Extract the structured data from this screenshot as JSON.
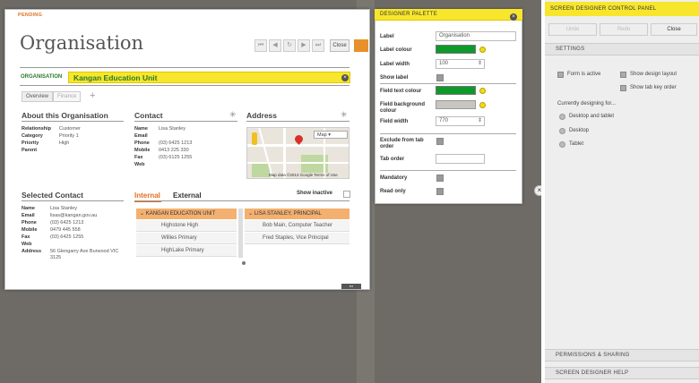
{
  "status": "PENDING",
  "title": "Organisation",
  "toolbar": {
    "first": "⏮",
    "prev": "◀",
    "refresh": "↻",
    "next": "▶",
    "last": "⏭",
    "close": "Close"
  },
  "org": {
    "label": "ORGANISATION",
    "name": "Kangan Education Unit"
  },
  "tabs": [
    "Overview",
    "Finance"
  ],
  "about": {
    "heading": "About this Organisation",
    "fields": [
      {
        "k": "Relationship",
        "v": "Customer"
      },
      {
        "k": "Category",
        "v": "Priority 1"
      },
      {
        "k": "Priority",
        "v": "High"
      },
      {
        "k": "Parent",
        "v": ""
      }
    ]
  },
  "contact": {
    "heading": "Contact",
    "fields": [
      {
        "k": "Name",
        "v": "Lisa Stanley"
      },
      {
        "k": "Email",
        "v": ""
      },
      {
        "k": "Phone",
        "v": "(03) 6425 1213"
      },
      {
        "k": "Mobile",
        "v": "0413 225 330"
      },
      {
        "k": "Fax",
        "v": "(03) 6125 1255"
      },
      {
        "k": "Web",
        "v": ""
      }
    ]
  },
  "address": {
    "heading": "Address",
    "map_type": "Map",
    "map_footer": "Map data ©2013 Google   Terms of Use"
  },
  "selected_contact": {
    "heading": "Selected Contact",
    "fields": [
      {
        "k": "Name",
        "v": "Lisa Stanley"
      },
      {
        "k": "Email",
        "v": "lisas@kangan.gov.au"
      },
      {
        "k": "Phone",
        "v": "(03) 6425 1213"
      },
      {
        "k": "Mobile",
        "v": "0479 445 558"
      },
      {
        "k": "Fax",
        "v": "(03) 6425 1255"
      },
      {
        "k": "Web",
        "v": ""
      },
      {
        "k": "Address",
        "v": "56 Glengarry Ave Burwood VIC 3125"
      }
    ]
  },
  "relations": {
    "tab_internal": "Internal",
    "tab_external": "External",
    "show_inactive": "Show inactive",
    "left": {
      "header": "KANGAN EDUCATION UNIT",
      "rows": [
        "Highstone High",
        "Willies Primary",
        "HighLake Primary"
      ]
    },
    "right": {
      "header": "LISA STANLEY, PRINCIPAL",
      "rows": [
        "Bob Main, Computer Teacher",
        "Fred Staples, Vice Principal"
      ]
    }
  },
  "palette": {
    "title": "DESIGNER PALETTE",
    "label_label": "Label",
    "label_value": "Organisation",
    "label_colour": "Label colour",
    "label_width": "Label width",
    "label_width_value": "100",
    "show_label": "Show label",
    "field_text_colour": "Field text colour",
    "field_bg_colour": "Field background colour",
    "field_width": "Field width",
    "field_width_value": "770",
    "exclude_tab": "Exclude from tab order",
    "tab_order": "Tab order",
    "mandatory": "Mandatory",
    "read_only": "Read only"
  },
  "control_panel": {
    "title": "SCREEN DESIGNER CONTROL PANEL",
    "undo": "Undo",
    "redo": "Redo",
    "close": "Close",
    "settings": "SETTINGS",
    "form_active": "Form is active",
    "show_design_layout": "Show design layout",
    "show_tab_key_order": "Show tab key order",
    "designing_for": "Currently designing for...",
    "options": [
      "Desktop and tablet",
      "Desktop",
      "Tablet"
    ],
    "permissions": "PERMISSIONS & SHARING",
    "help": "SCREEN DESIGNER HELP"
  },
  "colors": {
    "accent_yellow": "#f7e62c",
    "field_green": "#0d9a2a",
    "tab_orange": "#e07020",
    "header_orange": "#f3b070"
  }
}
